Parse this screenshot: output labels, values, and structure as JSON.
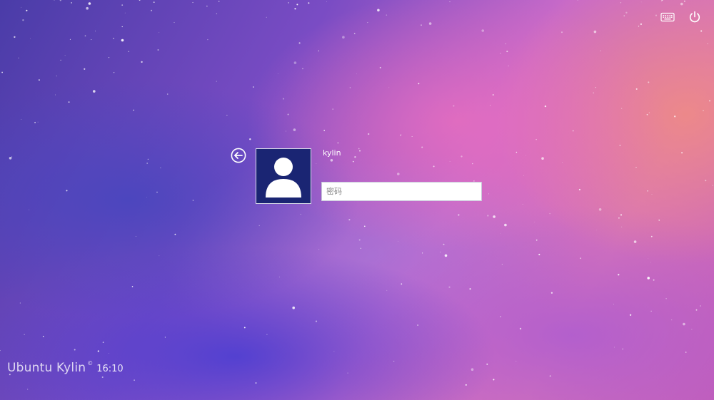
{
  "top_bar": {
    "keyboard_icon": "keyboard-icon",
    "power_icon": "power-icon"
  },
  "login": {
    "back_icon": "back-arrow-icon",
    "avatar_icon": "user-avatar-icon",
    "username": "kylin",
    "password_value": "",
    "password_placeholder": "密码"
  },
  "branding": {
    "name": "Ubuntu Kylin",
    "mark": "©",
    "clock": "16:10"
  },
  "colors": {
    "avatar_bg": "#1a2573",
    "text": "#ffffff"
  }
}
